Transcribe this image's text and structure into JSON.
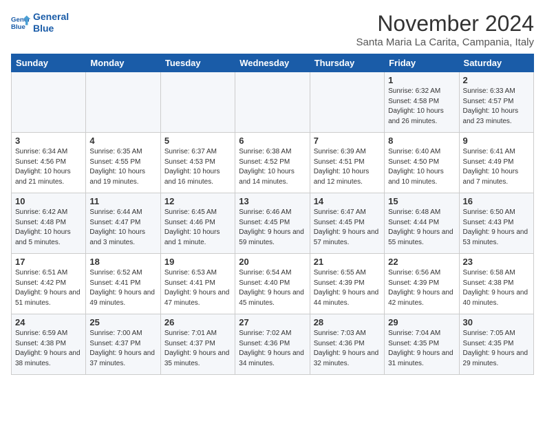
{
  "logo": {
    "line1": "General",
    "line2": "Blue"
  },
  "title": "November 2024",
  "location": "Santa Maria La Carita, Campania, Italy",
  "weekdays": [
    "Sunday",
    "Monday",
    "Tuesday",
    "Wednesday",
    "Thursday",
    "Friday",
    "Saturday"
  ],
  "weeks": [
    [
      {
        "day": "",
        "info": ""
      },
      {
        "day": "",
        "info": ""
      },
      {
        "day": "",
        "info": ""
      },
      {
        "day": "",
        "info": ""
      },
      {
        "day": "",
        "info": ""
      },
      {
        "day": "1",
        "info": "Sunrise: 6:32 AM\nSunset: 4:58 PM\nDaylight: 10 hours and 26 minutes."
      },
      {
        "day": "2",
        "info": "Sunrise: 6:33 AM\nSunset: 4:57 PM\nDaylight: 10 hours and 23 minutes."
      }
    ],
    [
      {
        "day": "3",
        "info": "Sunrise: 6:34 AM\nSunset: 4:56 PM\nDaylight: 10 hours and 21 minutes."
      },
      {
        "day": "4",
        "info": "Sunrise: 6:35 AM\nSunset: 4:55 PM\nDaylight: 10 hours and 19 minutes."
      },
      {
        "day": "5",
        "info": "Sunrise: 6:37 AM\nSunset: 4:53 PM\nDaylight: 10 hours and 16 minutes."
      },
      {
        "day": "6",
        "info": "Sunrise: 6:38 AM\nSunset: 4:52 PM\nDaylight: 10 hours and 14 minutes."
      },
      {
        "day": "7",
        "info": "Sunrise: 6:39 AM\nSunset: 4:51 PM\nDaylight: 10 hours and 12 minutes."
      },
      {
        "day": "8",
        "info": "Sunrise: 6:40 AM\nSunset: 4:50 PM\nDaylight: 10 hours and 10 minutes."
      },
      {
        "day": "9",
        "info": "Sunrise: 6:41 AM\nSunset: 4:49 PM\nDaylight: 10 hours and 7 minutes."
      }
    ],
    [
      {
        "day": "10",
        "info": "Sunrise: 6:42 AM\nSunset: 4:48 PM\nDaylight: 10 hours and 5 minutes."
      },
      {
        "day": "11",
        "info": "Sunrise: 6:44 AM\nSunset: 4:47 PM\nDaylight: 10 hours and 3 minutes."
      },
      {
        "day": "12",
        "info": "Sunrise: 6:45 AM\nSunset: 4:46 PM\nDaylight: 10 hours and 1 minute."
      },
      {
        "day": "13",
        "info": "Sunrise: 6:46 AM\nSunset: 4:45 PM\nDaylight: 9 hours and 59 minutes."
      },
      {
        "day": "14",
        "info": "Sunrise: 6:47 AM\nSunset: 4:45 PM\nDaylight: 9 hours and 57 minutes."
      },
      {
        "day": "15",
        "info": "Sunrise: 6:48 AM\nSunset: 4:44 PM\nDaylight: 9 hours and 55 minutes."
      },
      {
        "day": "16",
        "info": "Sunrise: 6:50 AM\nSunset: 4:43 PM\nDaylight: 9 hours and 53 minutes."
      }
    ],
    [
      {
        "day": "17",
        "info": "Sunrise: 6:51 AM\nSunset: 4:42 PM\nDaylight: 9 hours and 51 minutes."
      },
      {
        "day": "18",
        "info": "Sunrise: 6:52 AM\nSunset: 4:41 PM\nDaylight: 9 hours and 49 minutes."
      },
      {
        "day": "19",
        "info": "Sunrise: 6:53 AM\nSunset: 4:41 PM\nDaylight: 9 hours and 47 minutes."
      },
      {
        "day": "20",
        "info": "Sunrise: 6:54 AM\nSunset: 4:40 PM\nDaylight: 9 hours and 45 minutes."
      },
      {
        "day": "21",
        "info": "Sunrise: 6:55 AM\nSunset: 4:39 PM\nDaylight: 9 hours and 44 minutes."
      },
      {
        "day": "22",
        "info": "Sunrise: 6:56 AM\nSunset: 4:39 PM\nDaylight: 9 hours and 42 minutes."
      },
      {
        "day": "23",
        "info": "Sunrise: 6:58 AM\nSunset: 4:38 PM\nDaylight: 9 hours and 40 minutes."
      }
    ],
    [
      {
        "day": "24",
        "info": "Sunrise: 6:59 AM\nSunset: 4:38 PM\nDaylight: 9 hours and 38 minutes."
      },
      {
        "day": "25",
        "info": "Sunrise: 7:00 AM\nSunset: 4:37 PM\nDaylight: 9 hours and 37 minutes."
      },
      {
        "day": "26",
        "info": "Sunrise: 7:01 AM\nSunset: 4:37 PM\nDaylight: 9 hours and 35 minutes."
      },
      {
        "day": "27",
        "info": "Sunrise: 7:02 AM\nSunset: 4:36 PM\nDaylight: 9 hours and 34 minutes."
      },
      {
        "day": "28",
        "info": "Sunrise: 7:03 AM\nSunset: 4:36 PM\nDaylight: 9 hours and 32 minutes."
      },
      {
        "day": "29",
        "info": "Sunrise: 7:04 AM\nSunset: 4:35 PM\nDaylight: 9 hours and 31 minutes."
      },
      {
        "day": "30",
        "info": "Sunrise: 7:05 AM\nSunset: 4:35 PM\nDaylight: 9 hours and 29 minutes."
      }
    ]
  ]
}
